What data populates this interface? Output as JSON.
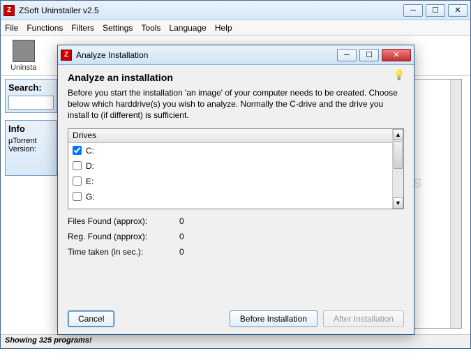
{
  "main_window": {
    "title": "ZSoft Uninstaller v2.5",
    "menu": [
      "File",
      "Functions",
      "Filters",
      "Settings",
      "Tools",
      "Language",
      "Help"
    ],
    "toolbar": {
      "uninstall_label": "Uninsta"
    },
    "search_panel": {
      "title": "Search:"
    },
    "info_panel": {
      "title": "Info",
      "line1": "µTorrent",
      "line2": "Version:"
    },
    "statusbar": "Showing 325 programs!"
  },
  "dialog": {
    "title": "Analyze Installation",
    "heading": "Analyze an installation",
    "description": "Before you start the installation 'an image' of your computer needs to be created. Choose below which harddrive(s) you wish to analyze. Normally the C-drive and the drive you install to (if different) is sufficient.",
    "drives_header": "Drives",
    "drives": [
      {
        "label": "C:",
        "checked": true
      },
      {
        "label": "D:",
        "checked": false
      },
      {
        "label": "E:",
        "checked": false
      },
      {
        "label": "G:",
        "checked": false
      }
    ],
    "stats": {
      "files_label": "Files Found (approx):",
      "files_value": "0",
      "reg_label": "Reg. Found (approx):",
      "reg_value": "0",
      "time_label": "Time taken (in sec.):",
      "time_value": "0"
    },
    "buttons": {
      "cancel": "Cancel",
      "before": "Before Installation",
      "after": "After Installation"
    }
  },
  "watermark": "SnapFiles"
}
